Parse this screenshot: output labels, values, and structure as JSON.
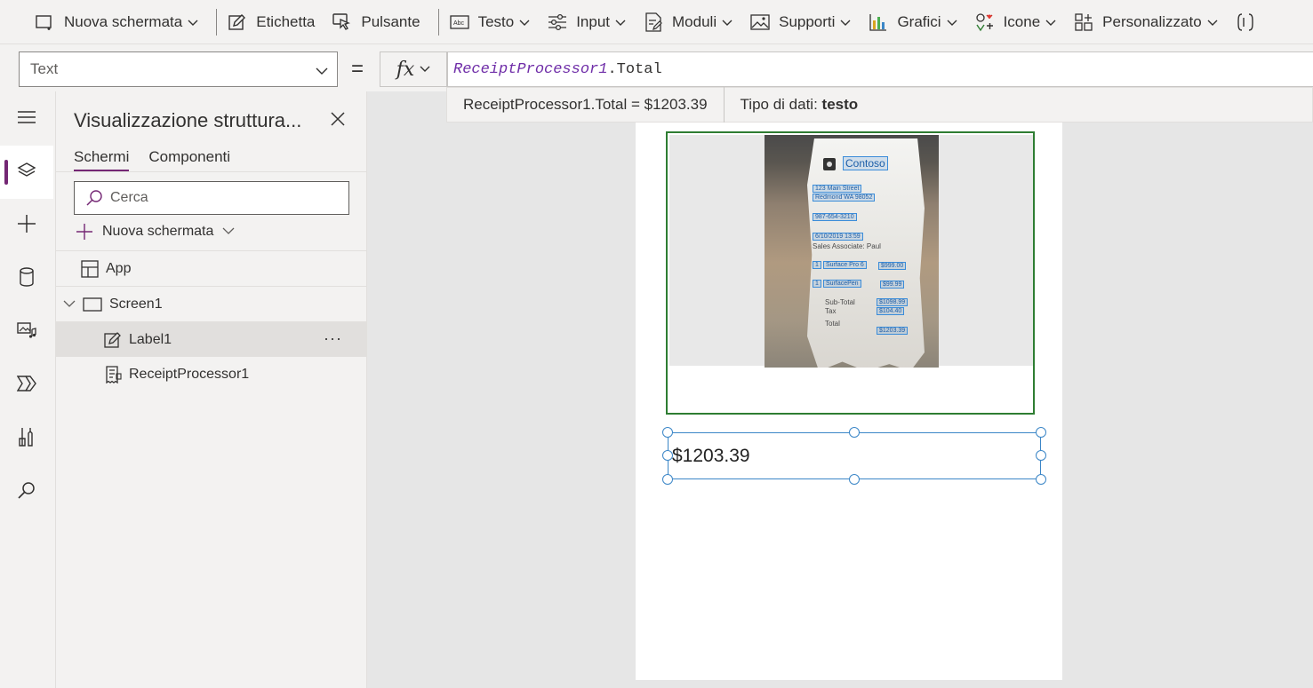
{
  "ribbon": {
    "items": [
      {
        "label": "Nuova schermata",
        "icon": "new-screen-icon",
        "chevron": true
      },
      {
        "label": "Etichetta",
        "icon": "label-edit-icon",
        "chevron": false
      },
      {
        "label": "Pulsante",
        "icon": "button-cursor-icon",
        "chevron": false
      },
      {
        "label": "Testo",
        "icon": "text-abc-icon",
        "chevron": true
      },
      {
        "label": "Input",
        "icon": "input-sliders-icon",
        "chevron": true
      },
      {
        "label": "Moduli",
        "icon": "forms-icon",
        "chevron": true
      },
      {
        "label": "Supporti",
        "icon": "media-image-icon",
        "chevron": true
      },
      {
        "label": "Grafici",
        "icon": "chart-icon",
        "chevron": true
      },
      {
        "label": "Icone",
        "icon": "icons-icon",
        "chevron": true
      },
      {
        "label": "Personalizzato",
        "icon": "custom-icon",
        "chevron": true
      }
    ]
  },
  "formula_bar": {
    "property": "Text",
    "equals": "=",
    "fx": "fx",
    "formula_object": "ReceiptProcessor1",
    "formula_property": ".Total",
    "result_expression": "ReceiptProcessor1.Total  =  $1203.39",
    "data_type_label": "Tipo di dati:",
    "data_type_value": "testo"
  },
  "tree_panel": {
    "title": "Visualizzazione struttura...",
    "tabs": [
      "Schermi",
      "Componenti"
    ],
    "active_tab": "Schermi",
    "search_placeholder": "Cerca",
    "new_screen_label": "Nuova schermata",
    "nodes": {
      "app": "App",
      "screen1": "Screen1",
      "label1": "Label1",
      "receipt_processor": "ReceiptProcessor1"
    },
    "more_label": "···"
  },
  "canvas": {
    "label_value": "$1203.39",
    "receipt": {
      "brand": "Contoso",
      "address1": "123 Main Street",
      "address2": "Redmond WA 98052",
      "phone": "987-654-3210",
      "date": "6/10/2019 13:59",
      "associate": "Sales Associate: Paul",
      "item1_qty": "1",
      "item1_name": "Surface Pro 6",
      "item1_price": "$999.00",
      "item2_qty": "1",
      "item2_name": "SurfacePen",
      "item2_price": "$99.99",
      "subtotal_label": "Sub-Total",
      "subtotal": "$1098.99",
      "tax_label": "Tax",
      "tax": "$104.40",
      "total_label": "Total",
      "total": "$1203.39"
    }
  },
  "colors": {
    "accent": "#742774",
    "selection": "#3b86c7",
    "processor_border": "#2e7d32",
    "bounding_box": "#3b8cd9"
  }
}
